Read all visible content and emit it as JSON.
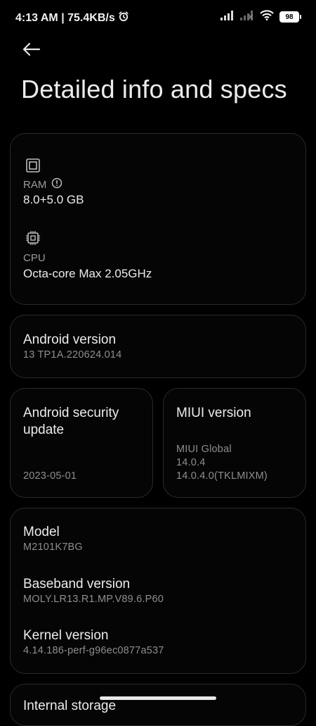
{
  "status_bar": {
    "time_speed": "4:13 AM | 75.4KB/s",
    "battery": "98"
  },
  "page": {
    "title": "Detailed info and specs"
  },
  "specs": {
    "ram_label": "RAM",
    "ram_value": "8.0+5.0 GB",
    "cpu_label": "CPU",
    "cpu_value": "Octa-core Max 2.05GHz"
  },
  "android": {
    "title": "Android version",
    "value": "13 TP1A.220624.014"
  },
  "security": {
    "title_line1": "Android security",
    "title_line2": "update",
    "value": "2023-05-01"
  },
  "miui": {
    "title": "MIUI version",
    "line1": "MIUI Global",
    "line2": "14.0.4",
    "line3": "14.0.4.0(TKLMIXM)"
  },
  "device": {
    "model_label": "Model",
    "model_value": "M2101K7BG",
    "baseband_label": "Baseband version",
    "baseband_value": "MOLY.LR13.R1.MP.V89.6.P60",
    "kernel_label": "Kernel version",
    "kernel_value": "4.14.186-perf-g96ec0877a537"
  },
  "peek": {
    "label": "Internal storage"
  },
  "icons": {
    "back": "arrow-back-icon",
    "alarm": "alarm-clock-icon",
    "signal1": "signal-icon",
    "signal2": "signal-off-icon",
    "wifi": "wifi-icon",
    "ram": "memory-chip-icon",
    "cpu": "cpu-chip-icon",
    "info": "info-icon"
  }
}
